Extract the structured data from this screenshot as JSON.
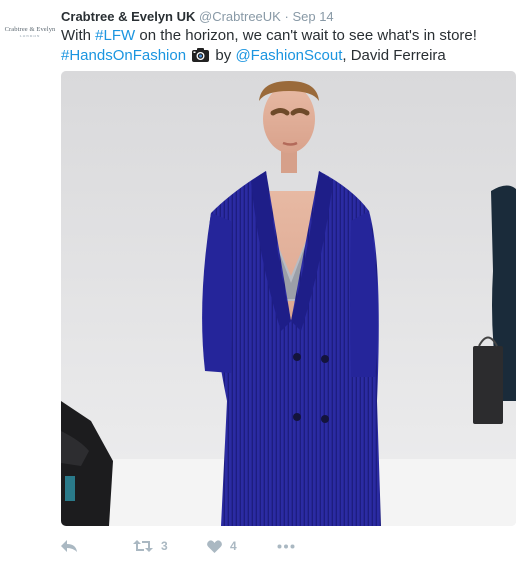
{
  "tweet": {
    "author_name": "Crabtree & Evelyn UK",
    "handle": "@CrabtreeUK",
    "separator": "·",
    "timestamp": "Sep 14",
    "avatar": {
      "line1": "Crabtree & Evelyn",
      "line2": "LONDON"
    },
    "text": {
      "part1": "With ",
      "hashtag1": "#LFW",
      "part2": " on the horizon, we can't wait to see what's in store!",
      "hashtag2": "#HandsOnFashion",
      "camera_icon": "camera-icon",
      "part3": " by ",
      "mention": "@FashionScout",
      "part4": ", David Ferreira"
    },
    "media": {
      "description_icon": "photo"
    },
    "actions": {
      "reply_icon": "reply-icon",
      "retweet_icon": "retweet-icon",
      "retweet_count": "3",
      "like_icon": "heart-icon",
      "like_count": "4",
      "more_icon": "more-icon"
    },
    "colors": {
      "link": "#1b95e0",
      "muted": "#8899a6",
      "icon": "#aab8c2",
      "coat": "#2a2aa0"
    }
  }
}
